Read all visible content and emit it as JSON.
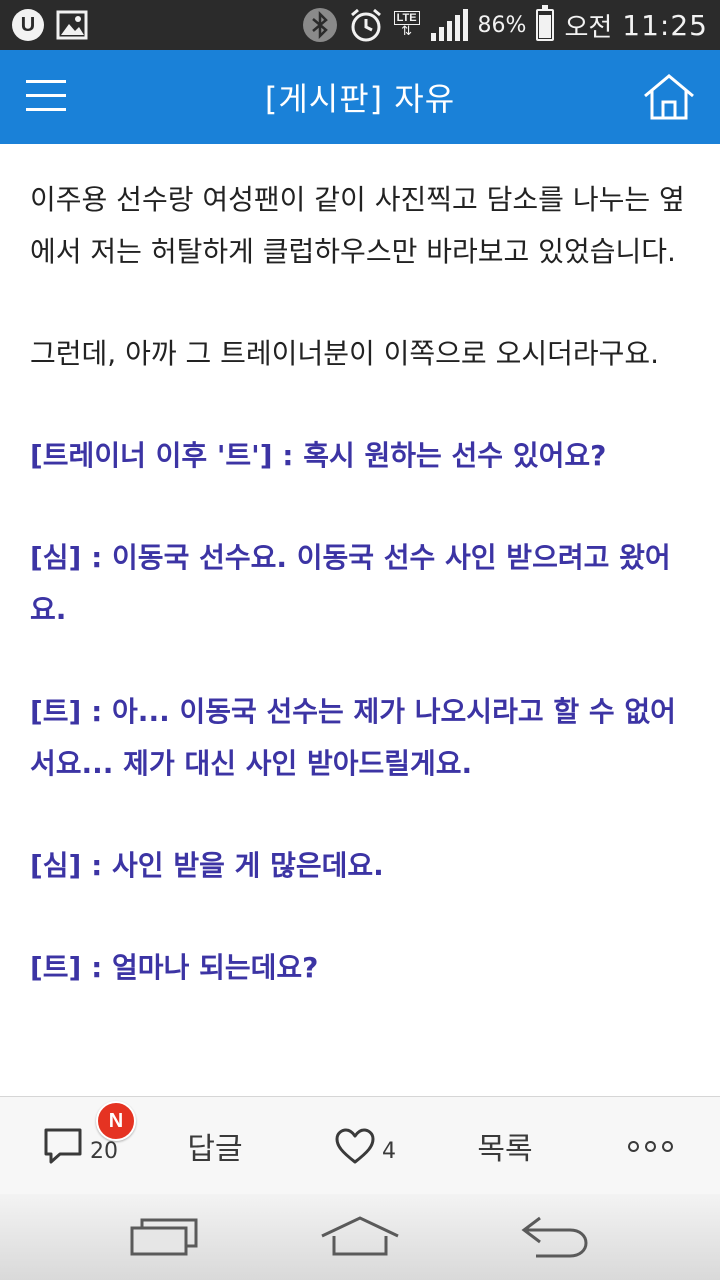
{
  "status_bar": {
    "app_badge": "U",
    "network": "LTE",
    "network_arrows": "⇅",
    "battery": "86%",
    "ampm": "오전",
    "time": "11:25"
  },
  "header": {
    "title": "[게시판] 자유"
  },
  "article": {
    "paragraphs": [
      {
        "text": "이주용 선수랑 여성팬이 같이 사진찍고 담소를 나누는 옆에서 저는 허탈하게 클럽하우스만 바라보고 있었습니다."
      },
      {
        "text": "그런데, 아까 그 트레이너분이 이쪽으로 오시더라구요."
      },
      {
        "text": "[트레이너 이후 '트'] : 혹시 원하는 선수 있어요?"
      },
      {
        "text": "[심] : 이동국 선수요. 이동국 선수 사인 받으려고 왔어요."
      },
      {
        "text": "[트] : 아... 이동국 선수는 제가 나오시라고 할 수 없어서요... 제가 대신 사인 받아드릴게요."
      },
      {
        "text": "[심] : 사인 받을 게 많은데요."
      },
      {
        "text": "[트] : 얼마나 되는데요?"
      }
    ]
  },
  "action_bar": {
    "comment_count": "20",
    "new_badge": "N",
    "reply_label": "답글",
    "like_count": "4",
    "list_label": "목록"
  },
  "colors": {
    "header": "#1a81d8",
    "dialog_text": "#3c34a4",
    "body_text": "#222222",
    "badge": "#e53322"
  }
}
